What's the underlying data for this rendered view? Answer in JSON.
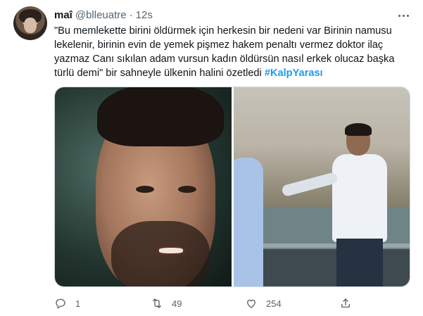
{
  "user": {
    "name": "maî",
    "handle": "@blleuatre",
    "separator": "·",
    "time": "12s"
  },
  "tweet": {
    "text": "\"Bu memlekette birini öldürmek için herkesin bir nedeni var Birinin namusu lekelenir, birinin evin de yemek pişmez hakem penaltı vermez doktor ilaç yazmaz Canı sıkılan adam vursun kadın öldürsün nasıl erkek olucaz başka türlü demi\" bir sahneyle ülkenin halini özetledi",
    "hashtag": "#KalpYarası"
  },
  "actions": {
    "reply": {
      "icon": "reply-icon",
      "count": "1"
    },
    "retweet": {
      "icon": "retweet-icon",
      "count": "49"
    },
    "like": {
      "icon": "heart-icon",
      "count": "254"
    },
    "share": {
      "icon": "share-icon"
    }
  },
  "colors": {
    "accent": "#1d9bf0",
    "text": "#0f1419",
    "muted": "#536471"
  }
}
